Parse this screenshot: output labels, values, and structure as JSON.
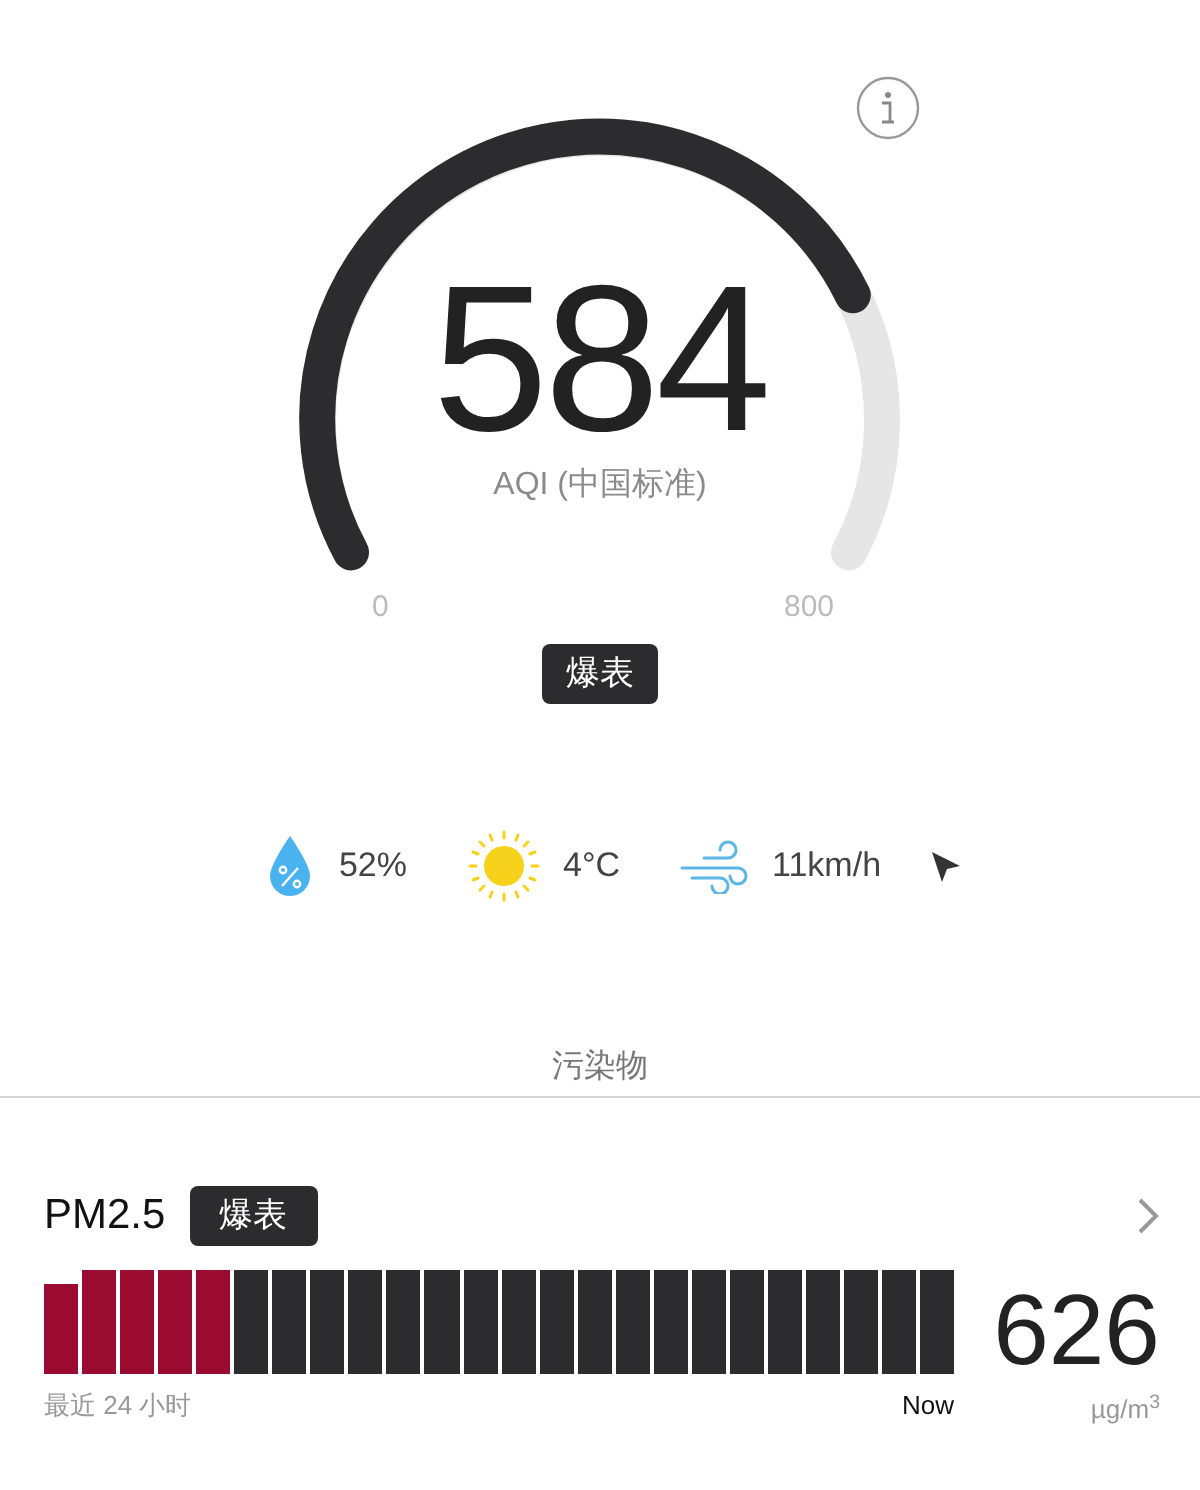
{
  "gauge": {
    "value": "584",
    "label": "AQI (中国标准)",
    "min": "0",
    "max": "800",
    "badge": "爆表"
  },
  "weather": [
    {
      "kind": "humidity",
      "value": "52%"
    },
    {
      "kind": "temperature",
      "value": "4°C"
    },
    {
      "kind": "wind",
      "value": "11km/h"
    }
  ],
  "section_title": "污染物",
  "pollutant": {
    "name": "PM2.5",
    "badge": "爆表",
    "value": "626",
    "unit": "µg/m$^{3}$",
    "range_start": "最近 24 小时",
    "range_end": "Now",
    "bars": [
      {
        "color": "#9b0b31"
      },
      {
        "color": "#9b0b31"
      },
      {
        "color": "#9b0b31"
      },
      {
        "color": "#9b0b31"
      },
      {
        "color": "#9b0b31"
      },
      {
        "color": "#2c2b2e"
      },
      {
        "color": "#2c2b2e"
      },
      {
        "color": "#2c2b2e"
      },
      {
        "color": "#2c2b2e"
      },
      {
        "color": "#2c2b2e"
      },
      {
        "color": "#2c2b2e"
      },
      {
        "color": "#2c2b2e"
      },
      {
        "color": "#2c2b2e"
      },
      {
        "color": "#2c2b2e"
      },
      {
        "color": "#2c2b2e"
      },
      {
        "color": "#2c2b2e"
      },
      {
        "color": "#2c2b2e"
      },
      {
        "color": "#2c2b2e"
      },
      {
        "color": "#2c2b2e"
      },
      {
        "color": "#2c2b2e"
      },
      {
        "color": "#2c2b2e"
      },
      {
        "color": "#2c2b2e"
      },
      {
        "color": "#2c2b2e"
      },
      {
        "color": "#2c2b2e"
      }
    ]
  }
}
